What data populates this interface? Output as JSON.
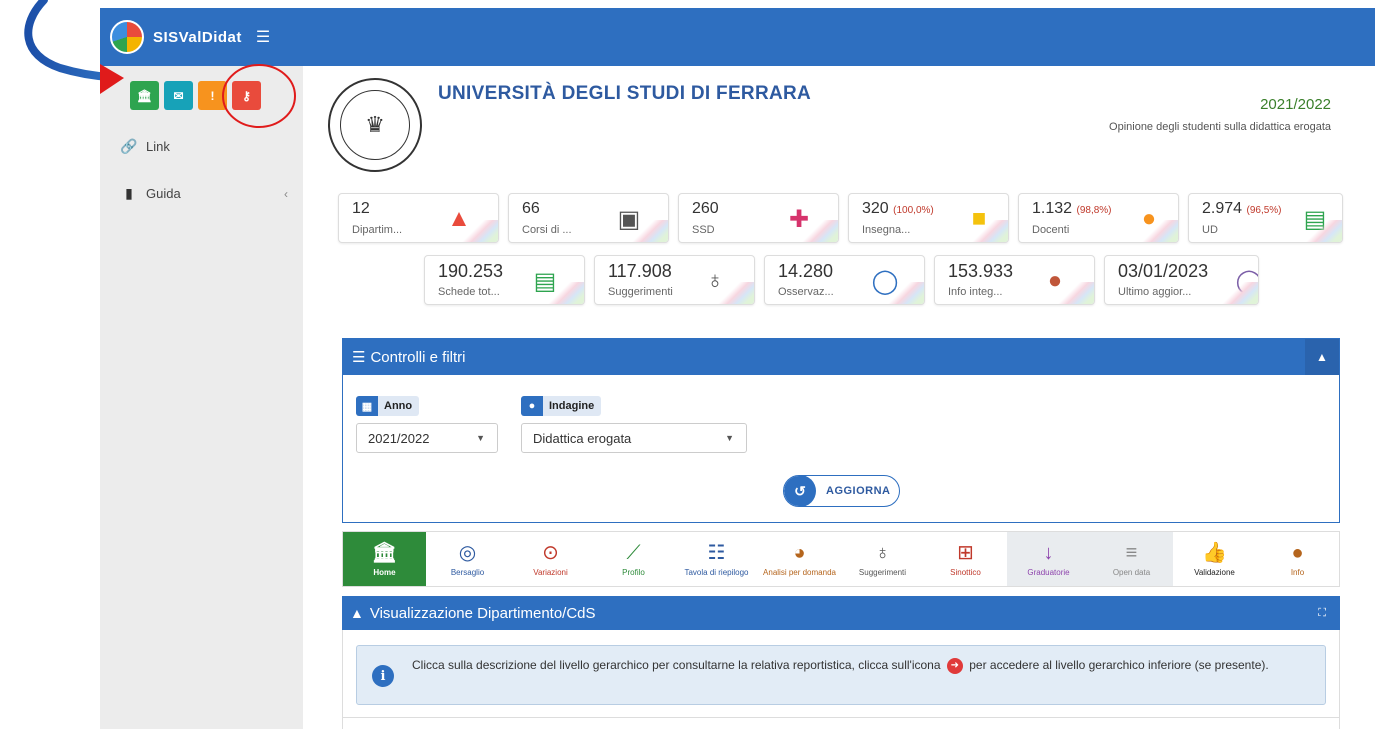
{
  "app": {
    "name": "SISValDidat"
  },
  "sidebar": {
    "items": [
      {
        "label": "Link",
        "icon": "link-icon"
      },
      {
        "label": "Guida",
        "icon": "book-icon"
      }
    ]
  },
  "university": {
    "name": "UNIVERSITÀ DEGLI STUDI DI FERRARA",
    "year": "2021/2022",
    "subtitle": "Opinione degli studenti sulla didattica erogata"
  },
  "stats": [
    {
      "value": "12",
      "pct": "",
      "label": "Dipartim...",
      "icon": "building-icon",
      "color": "#e94b3c"
    },
    {
      "value": "66",
      "pct": "",
      "label": "Corsi di ...",
      "icon": "chalkboard-icon",
      "color": "#555555"
    },
    {
      "value": "260",
      "pct": "",
      "label": "SSD",
      "icon": "puzzle-icon",
      "color": "#d6336c"
    },
    {
      "value": "320",
      "pct": "(100,0%)",
      "label": "Insegna...",
      "icon": "open-book-icon",
      "color": "#f4c20d"
    },
    {
      "value": "1.132",
      "pct": "(98,8%)",
      "label": "Docenti",
      "icon": "users-icon",
      "color": "#f7931e"
    },
    {
      "value": "2.974",
      "pct": "(96,5%)",
      "label": "UD",
      "icon": "contact-card-icon",
      "color": "#2ea44f"
    },
    {
      "value": "190.253",
      "pct": "",
      "label": "Schede tot...",
      "icon": "file-icon",
      "color": "#2ea44f"
    },
    {
      "value": "117.908",
      "pct": "",
      "label": "Suggerimenti",
      "icon": "lightbulb-icon",
      "color": "#555555"
    },
    {
      "value": "14.280",
      "pct": "",
      "label": "Osservaz...",
      "icon": "comment-icon",
      "color": "#2e6fc0"
    },
    {
      "value": "153.933",
      "pct": "",
      "label": "Info integ...",
      "icon": "info-circle-icon",
      "color": "#c0563a"
    },
    {
      "value": "03/01/2023",
      "pct": "",
      "label": "Ultimo aggior...",
      "icon": "clock-icon",
      "color": "#7b5ea7"
    }
  ],
  "controls": {
    "title": "Controlli e filtri",
    "anno_label": "Anno",
    "anno_value": "2021/2022",
    "indagine_label": "Indagine",
    "indagine_value": "Didattica erogata",
    "update_label": "AGGIORNA"
  },
  "nav": [
    {
      "label": "Home",
      "icon": "institution-icon",
      "color": "#ffffff"
    },
    {
      "label": "Bersaglio",
      "icon": "target-icon",
      "color": "#2e5aa0"
    },
    {
      "label": "Variazioni",
      "icon": "dot-circle-icon",
      "color": "#c0392b"
    },
    {
      "label": "Profilo",
      "icon": "line-chart-icon",
      "color": "#2e8b3a"
    },
    {
      "label": "Tavola di riepilogo",
      "icon": "list-icon",
      "color": "#2e5aa0"
    },
    {
      "label": "Analisi per domanda",
      "icon": "gauge-icon",
      "color": "#b5651d"
    },
    {
      "label": "Suggerimenti",
      "icon": "lightbulb-icon",
      "color": "#555555"
    },
    {
      "label": "Sinottico",
      "icon": "table-icon",
      "color": "#c0392b"
    },
    {
      "label": "Graduatorie",
      "icon": "sort-numeric-icon",
      "color": "#8e44ad"
    },
    {
      "label": "Open data",
      "icon": "database-icon",
      "color": "#888888"
    },
    {
      "label": "Validazione",
      "icon": "thumbs-up-icon",
      "color": "#222222"
    },
    {
      "label": "Info",
      "icon": "info-circle-icon",
      "color": "#b5651d"
    }
  ],
  "visualization": {
    "title": "Visualizzazione Dipartimento/CdS",
    "info_text_a": "Clicca sulla descrizione del livello gerarchico per consultarne la relativa reportistica, clicca sull'icona",
    "info_text_b": "per accedere al livello gerarchico inferiore (se presente)."
  },
  "colors": {
    "primary": "#2e6fc0",
    "sidebar_bg": "#ececec",
    "active_nav": "#2e8b3a",
    "annotation_red": "#e01b1b"
  }
}
